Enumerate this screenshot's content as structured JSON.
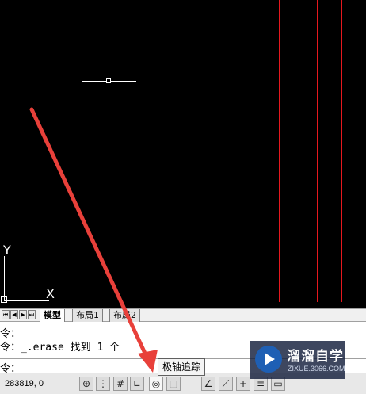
{
  "layout_tabs": {
    "model": "模型",
    "layout1": "布局1",
    "layout2": "布局2"
  },
  "command_line": {
    "line1": "令：",
    "line2": "令：_.erase 找到 1 个",
    "prompt": "令："
  },
  "ucs": {
    "x_label": "X",
    "y_label": "Y"
  },
  "status_bar": {
    "coordinates": "283819, 0",
    "buttons": [
      {
        "name": "snap-infer",
        "glyph": "⊕"
      },
      {
        "name": "snap-mode",
        "glyph": "⋮"
      },
      {
        "name": "grid-display",
        "glyph": "#"
      },
      {
        "name": "ortho-mode",
        "glyph": "∟"
      },
      {
        "name": "polar-tracking",
        "glyph": "◎"
      },
      {
        "name": "object-snap",
        "glyph": "□"
      },
      {
        "name": "object-snap-tracking",
        "glyph": "∠"
      },
      {
        "name": "dynamic-ucs",
        "glyph": "⟋"
      },
      {
        "name": "dynamic-input",
        "glyph": "+"
      },
      {
        "name": "lineweight",
        "glyph": "≡"
      },
      {
        "name": "selection-cycling",
        "glyph": "▭"
      }
    ]
  },
  "tooltip": {
    "text": "极轴追踪"
  },
  "watermark": {
    "title": "溜溜自学",
    "url": "ZIXUE.3066.COM"
  },
  "colors": {
    "drawing_line": "#e6181e",
    "annotation_arrow": "#e8403a",
    "canvas": "#000000"
  }
}
